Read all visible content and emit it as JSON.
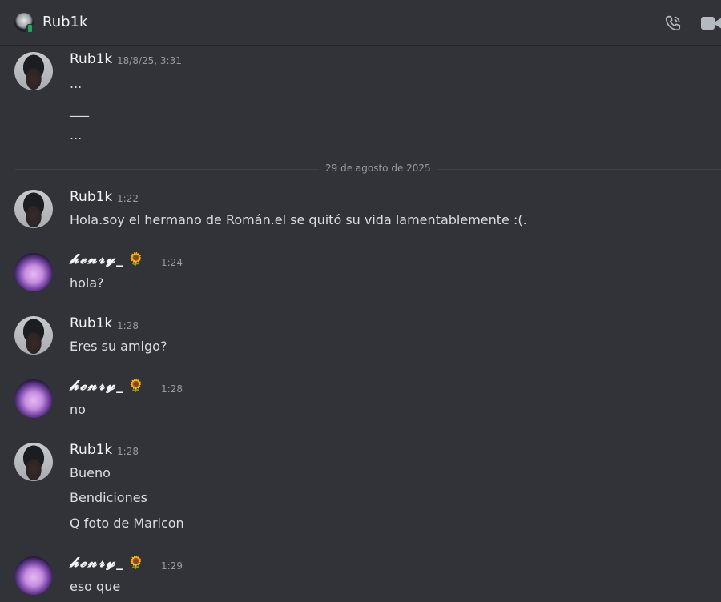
{
  "header": {
    "title": "Rub1k",
    "icons": [
      "phone-call-icon",
      "video-camera-icon"
    ]
  },
  "divider": {
    "date": "29 de agosto de 2025"
  },
  "messages": [
    {
      "author": "Rub1k",
      "time": "18/8/25, 3:31",
      "lines": [
        "...",
        "___",
        "..."
      ]
    },
    {
      "author": "Rub1k",
      "time": "1:22",
      "lines": [
        "Hola.soy el hermano de Román.el se quitó su vida lamentablemente :(."
      ]
    },
    {
      "author": "𝓱𝓮𝓷𝓻𝔂_",
      "badge": "🌻",
      "time": "1:24",
      "lines": [
        "hola?"
      ]
    },
    {
      "author": "Rub1k",
      "time": "1:28",
      "lines": [
        "Eres su amigo?"
      ]
    },
    {
      "author": "𝓱𝓮𝓷𝓻𝔂_",
      "badge": "🌻",
      "time": "1:28",
      "lines": [
        "no"
      ]
    },
    {
      "author": "Rub1k",
      "time": "1:28",
      "lines": [
        "Bueno",
        "Bendiciones",
        "Q foto de Maricon"
      ]
    },
    {
      "author": "𝓱𝓮𝓷𝓻𝔂_",
      "badge": "🌻",
      "time": "1:29",
      "lines": [
        "eso que"
      ]
    }
  ],
  "colors": {
    "background": "#313338",
    "text": "#dbdee1",
    "muted": "#949ba4",
    "online": "#23a55a"
  }
}
